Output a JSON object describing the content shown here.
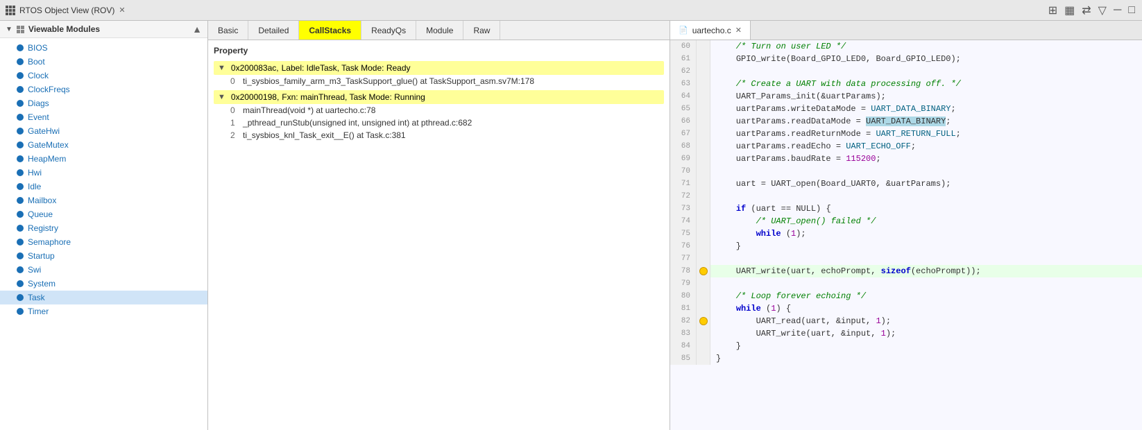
{
  "titleBar": {
    "leftTitle": "RTOS Object View (ROV)",
    "rightTitle": "uartecho.c",
    "closeLabel": "✕"
  },
  "toolbar": {
    "icons": [
      "⊞",
      "▦",
      "⇄",
      "▽",
      "─",
      "□"
    ]
  },
  "leftPanel": {
    "header": "Viewable Modules",
    "items": [
      {
        "label": "BIOS",
        "selected": false
      },
      {
        "label": "Boot",
        "selected": false
      },
      {
        "label": "Clock",
        "selected": false
      },
      {
        "label": "ClockFreqs",
        "selected": false
      },
      {
        "label": "Diags",
        "selected": false
      },
      {
        "label": "Event",
        "selected": false
      },
      {
        "label": "GateHwi",
        "selected": false
      },
      {
        "label": "GateMutex",
        "selected": false
      },
      {
        "label": "HeapMem",
        "selected": false
      },
      {
        "label": "Hwi",
        "selected": false
      },
      {
        "label": "Idle",
        "selected": false
      },
      {
        "label": "Mailbox",
        "selected": false
      },
      {
        "label": "Queue",
        "selected": false
      },
      {
        "label": "Registry",
        "selected": false
      },
      {
        "label": "Semaphore",
        "selected": false
      },
      {
        "label": "Startup",
        "selected": false
      },
      {
        "label": "Swi",
        "selected": false
      },
      {
        "label": "System",
        "selected": false
      },
      {
        "label": "Task",
        "selected": true
      },
      {
        "label": "Timer",
        "selected": false
      }
    ]
  },
  "tabs": {
    "items": [
      "Basic",
      "Detailed",
      "CallStacks",
      "ReadyQs",
      "Module",
      "Raw"
    ],
    "activeIndex": 2
  },
  "callStacks": {
    "propertyHeader": "Property",
    "entries": [
      {
        "address": "0x200083ac",
        "label": "Label: IdleTask,  Task Mode: Ready",
        "expanded": true,
        "frames": [
          {
            "index": "0",
            "text": "ti_sysbios_family_arm_m3_TaskSupport_glue() at TaskSupport_asm.sv7M:178"
          }
        ]
      },
      {
        "address": "0x20000198",
        "label": "Fxn: mainThread,  Task Mode: Running",
        "expanded": true,
        "frames": [
          {
            "index": "0",
            "text": "mainThread(void *) at uartecho.c:78"
          },
          {
            "index": "1",
            "text": "_pthread_runStub(unsigned int, unsigned int) at pthread.c:682"
          },
          {
            "index": "2",
            "text": "ti_sysbios_knl_Task_exit__E() at Task.c:381"
          }
        ]
      }
    ]
  },
  "codeEditor": {
    "filename": "uartecho.c",
    "lines": [
      {
        "num": 60,
        "text": "    /* Turn on user LED */",
        "type": "comment",
        "highlight": false,
        "breakpoint": false
      },
      {
        "num": 61,
        "text": "    GPIO_write(Board_GPIO_LED0, Board_GPIO_LED0);",
        "type": "code",
        "highlight": false,
        "breakpoint": false
      },
      {
        "num": 62,
        "text": "",
        "type": "empty",
        "highlight": false,
        "breakpoint": false
      },
      {
        "num": 63,
        "text": "    /* Create a UART with data processing off. */",
        "type": "comment",
        "highlight": false,
        "breakpoint": false
      },
      {
        "num": 64,
        "text": "    UART_Params_init(&uartParams);",
        "type": "code",
        "highlight": false,
        "breakpoint": false
      },
      {
        "num": 65,
        "text": "    uartParams.writeDataMode = UART_DATA_BINARY;",
        "type": "code",
        "highlight": false,
        "breakpoint": false
      },
      {
        "num": 66,
        "text": "    uartParams.readDataMode = UART_DATA_BINARY;",
        "type": "code",
        "highlight": false,
        "breakpoint": false,
        "selectedPart": "UART_DATA_BINARY"
      },
      {
        "num": 67,
        "text": "    uartParams.readReturnMode = UART_RETURN_FULL;",
        "type": "code",
        "highlight": false,
        "breakpoint": false
      },
      {
        "num": 68,
        "text": "    uartParams.readEcho = UART_ECHO_OFF;",
        "type": "code",
        "highlight": false,
        "breakpoint": false
      },
      {
        "num": 69,
        "text": "    uartParams.baudRate = 115200;",
        "type": "code",
        "highlight": false,
        "breakpoint": false
      },
      {
        "num": 70,
        "text": "",
        "type": "empty",
        "highlight": false,
        "breakpoint": false
      },
      {
        "num": 71,
        "text": "    uart = UART_open(Board_UART0, &uartParams);",
        "type": "code",
        "highlight": false,
        "breakpoint": false
      },
      {
        "num": 72,
        "text": "",
        "type": "empty",
        "highlight": false,
        "breakpoint": false
      },
      {
        "num": 73,
        "text": "    if (uart == NULL) {",
        "type": "code",
        "highlight": false,
        "breakpoint": false
      },
      {
        "num": 74,
        "text": "        /* UART_open() failed */",
        "type": "comment",
        "highlight": false,
        "breakpoint": false
      },
      {
        "num": 75,
        "text": "        while (1);",
        "type": "code",
        "highlight": false,
        "breakpoint": false
      },
      {
        "num": 76,
        "text": "    }",
        "type": "code",
        "highlight": false,
        "breakpoint": false
      },
      {
        "num": 77,
        "text": "",
        "type": "empty",
        "highlight": false,
        "breakpoint": false
      },
      {
        "num": 78,
        "text": "    UART_write(uart, echoPrompt, sizeof(echoPrompt));",
        "type": "code",
        "highlight": true,
        "breakpoint": true
      },
      {
        "num": 79,
        "text": "",
        "type": "empty",
        "highlight": false,
        "breakpoint": false
      },
      {
        "num": 80,
        "text": "    /* Loop forever echoing */",
        "type": "comment",
        "highlight": false,
        "breakpoint": false
      },
      {
        "num": 81,
        "text": "    while (1) {",
        "type": "code",
        "highlight": false,
        "breakpoint": false
      },
      {
        "num": 82,
        "text": "        UART_read(uart, &input, 1);",
        "type": "code",
        "highlight": false,
        "breakpoint": true
      },
      {
        "num": 83,
        "text": "        UART_write(uart, &input, 1);",
        "type": "code",
        "highlight": false,
        "breakpoint": false
      },
      {
        "num": 84,
        "text": "    }",
        "type": "code",
        "highlight": false,
        "breakpoint": false
      },
      {
        "num": 85,
        "text": "}",
        "type": "code",
        "highlight": false,
        "breakpoint": false
      }
    ]
  }
}
